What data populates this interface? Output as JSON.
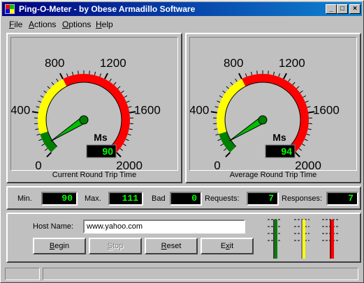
{
  "window": {
    "title": "Ping-O-Meter - by Obese Armadillo Software",
    "controls": {
      "minimize": "_",
      "maximize": "□",
      "close": "×"
    }
  },
  "menu": [
    {
      "label": "File",
      "accel": "F"
    },
    {
      "label": "Actions",
      "accel": "A"
    },
    {
      "label": "Options",
      "accel": "O"
    },
    {
      "label": "Help",
      "accel": "H"
    }
  ],
  "gauges": [
    {
      "caption": "Current Round Trip Time",
      "unit": "Ms",
      "value": 90,
      "display": "90",
      "scale_min": 0,
      "scale_max": 2000,
      "tick_labels": [
        "0",
        "400",
        "800",
        "1200",
        "1600",
        "2000"
      ],
      "zones": {
        "green_end": 200,
        "yellow_end": 800,
        "red_end": 2000
      }
    },
    {
      "caption": "Average Round Trip Time",
      "unit": "Ms",
      "value": 94,
      "display": "94",
      "scale_min": 0,
      "scale_max": 2000,
      "tick_labels": [
        "0",
        "400",
        "800",
        "1200",
        "1600",
        "2000"
      ],
      "zones": {
        "green_end": 200,
        "yellow_end": 800,
        "red_end": 2000
      }
    }
  ],
  "stats": {
    "min": {
      "label": "Min.",
      "value": "90"
    },
    "max": {
      "label": "Max.",
      "value": "111"
    },
    "bad": {
      "label": "Bad",
      "value": "0"
    },
    "requests": {
      "label": "Requests:",
      "value": "7"
    },
    "responses": {
      "label": "Responses:",
      "value": "7"
    }
  },
  "host": {
    "label": "Host Name:",
    "value": "www.yahoo.com"
  },
  "buttons": {
    "begin": {
      "label": "Begin",
      "accel": "B"
    },
    "stop": {
      "label": "Stop",
      "accel": "S"
    },
    "reset": {
      "label": "Reset",
      "accel": "R"
    },
    "exit": {
      "label": "Exit",
      "accel": "x"
    }
  },
  "colors": {
    "title_start": "#000080",
    "title_end": "#1084d0",
    "lcd_bg": "#000000",
    "lcd_text": "#00ff00",
    "zone_green": "#008000",
    "zone_yellow": "#ffff00",
    "zone_red": "#ff0000",
    "needle": "#00c000"
  },
  "icons": [
    "app-icon",
    "minimize-icon",
    "maximize-icon",
    "close-icon"
  ]
}
